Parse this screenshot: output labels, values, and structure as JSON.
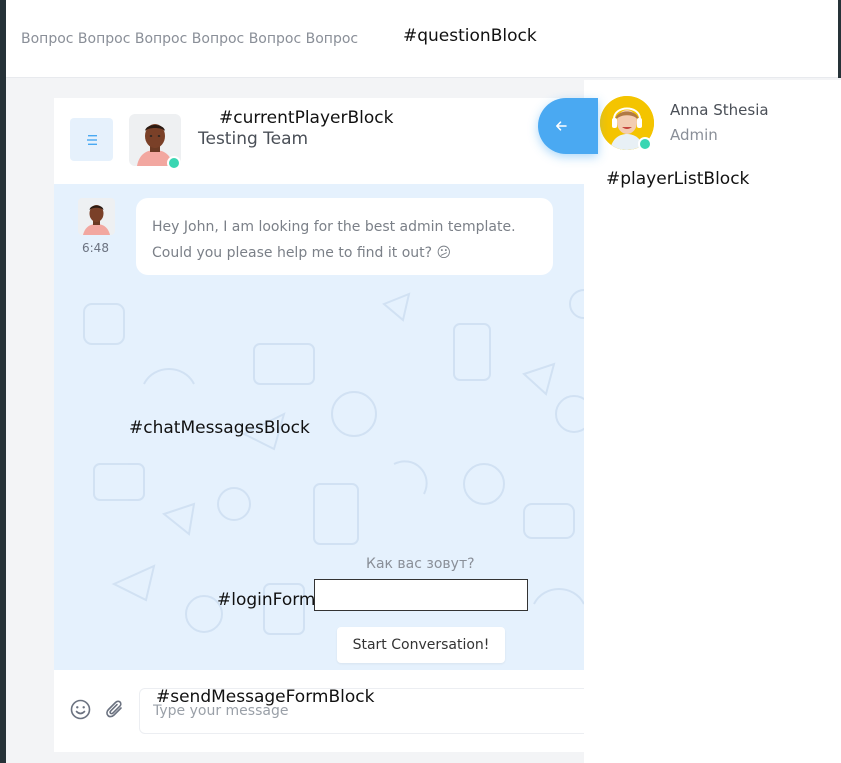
{
  "header": {
    "question_text": "Вопрос Вопрос Вопрос Вопрос Вопрос Вопрос",
    "question_block_label": "#questionBlock"
  },
  "chat": {
    "current_player_label": "#currentPlayerBlock",
    "team_name": "Testing Team",
    "messages": [
      {
        "time": "6:48",
        "text": "Hey John, I am looking for the best admin template. Could you please help me to find it out? 😕"
      }
    ],
    "chat_messages_label": "#chatMessagesBlock"
  },
  "login_form": {
    "question": "Как вас зовут?",
    "label": "#loginFormBlock",
    "input_value": "",
    "button_label": "Start Conversation!"
  },
  "send_form": {
    "label": "#sendMessageFormBlock",
    "placeholder": "Type your message",
    "emoji_icon": "emoji-icon",
    "attach_icon": "paperclip-icon"
  },
  "player_list": {
    "label": "#playerListBlock",
    "players": [
      {
        "name": "Anna Sthesia",
        "role": "Admin",
        "status": "online"
      }
    ]
  },
  "colors": {
    "accent": "#4aa9f2",
    "chat_bg": "#e5f1fd",
    "online": "#39d6b2"
  }
}
